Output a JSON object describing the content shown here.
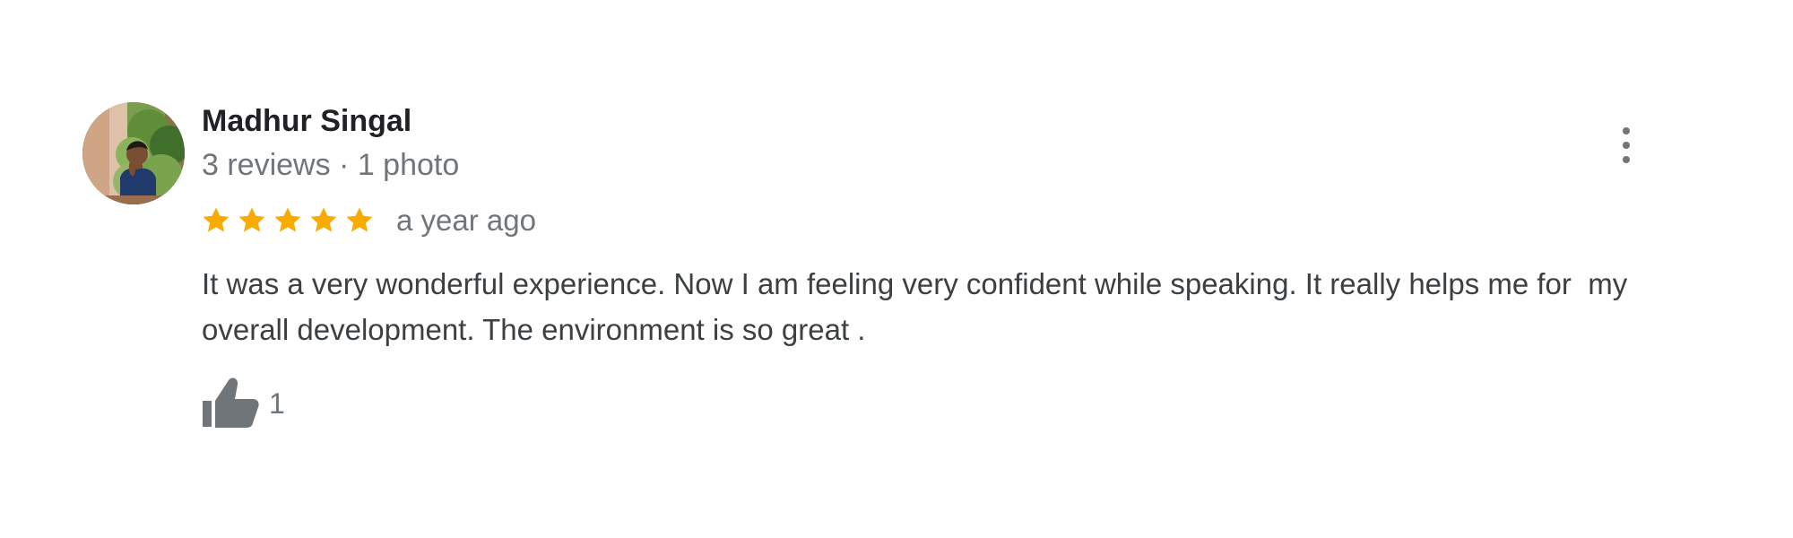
{
  "review": {
    "reviewer": {
      "name": "Madhur Singal",
      "meta": "3 reviews · 1 photo",
      "avatar_icon": "profile-photo"
    },
    "rating": {
      "value": 5,
      "max": 5,
      "star_icon": "filled-star",
      "star_color": "#f9ab00"
    },
    "date": "a year ago",
    "text": "It was a very wonderful experience. Now I am feeling very confident while speaking. It really helps me for  my overall development. The environment is so great .",
    "actions": {
      "more_icon": "vertical-more-icon",
      "like_icon": "thumbs-up-icon",
      "like_count": "1",
      "icon_color": "#70757a"
    }
  }
}
